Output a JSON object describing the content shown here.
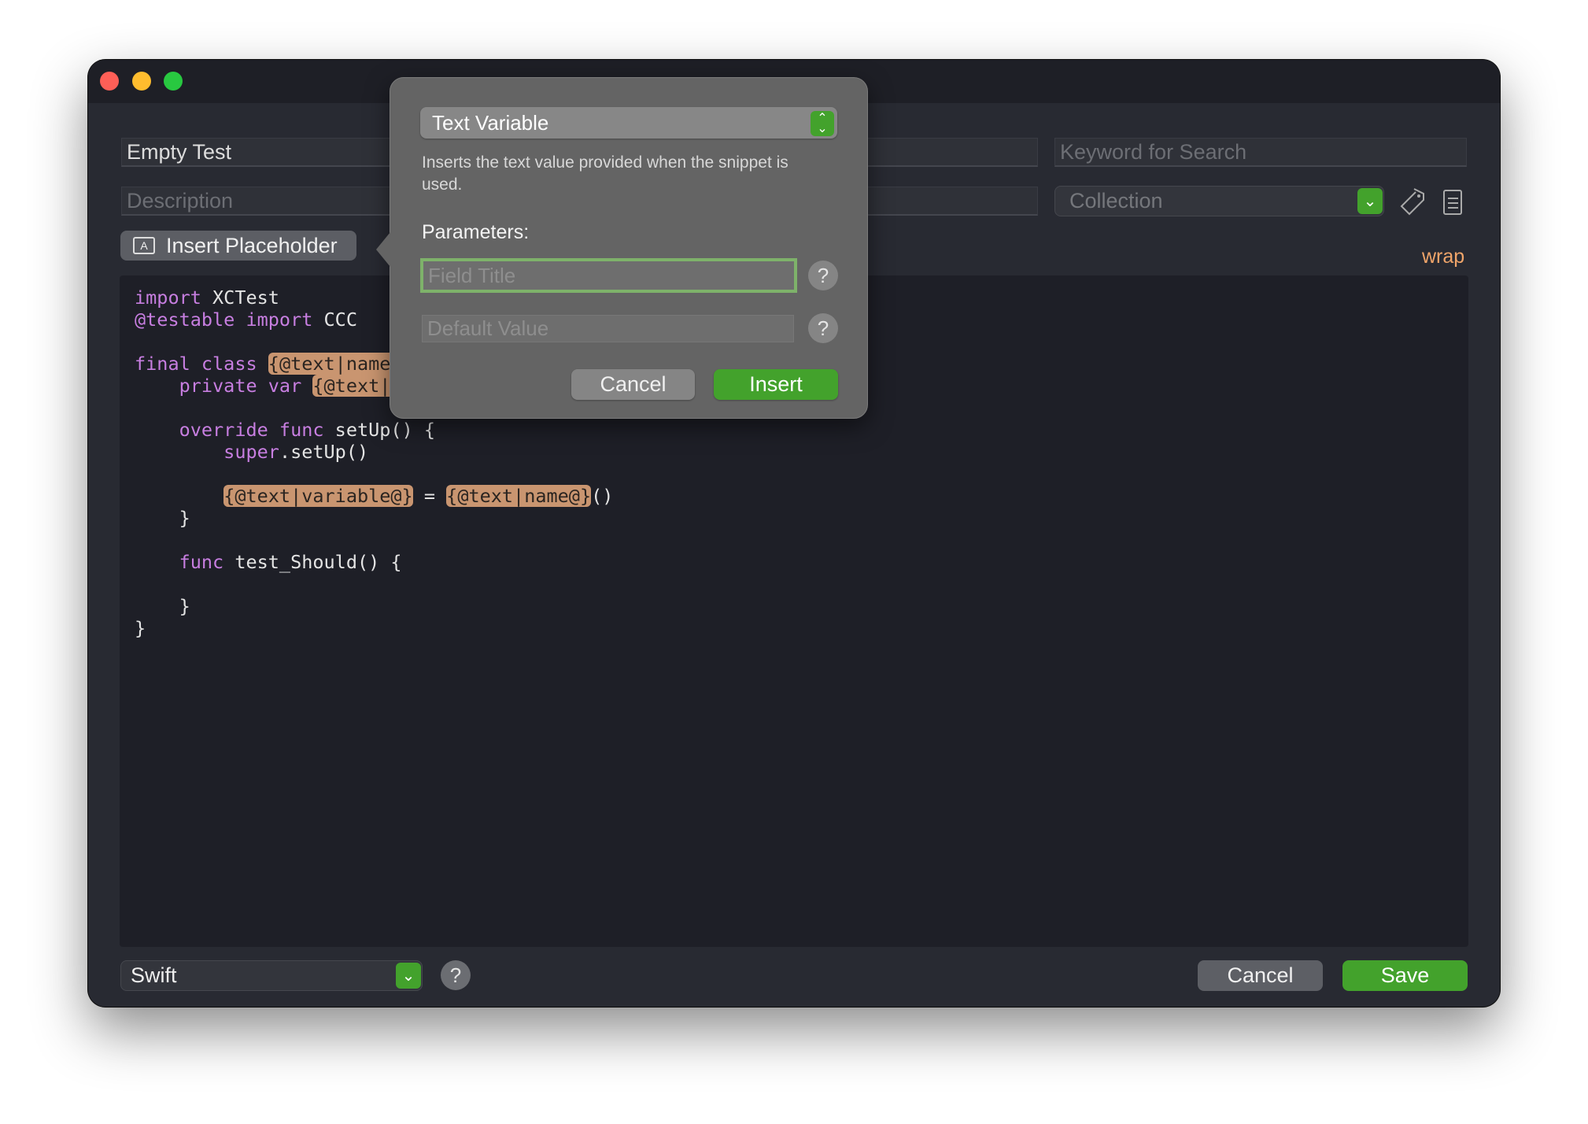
{
  "colors": {
    "accent": "#43a22c",
    "placeholder_highlight": "#c99570",
    "keyword": "#c77ee0",
    "wrap": "#f0a56a"
  },
  "form": {
    "name_value": "Empty Test",
    "description_placeholder": "Description",
    "keyword_placeholder": "Keyword for Search",
    "collection_placeholder": "Collection",
    "insert_placeholder_label": "Insert Placeholder",
    "wrap_label": "wrap"
  },
  "code": {
    "lines": [
      [
        {
          "t": "import",
          "k": "kw"
        },
        {
          "t": " XCTest",
          "k": "p"
        }
      ],
      [
        {
          "t": "@testable import",
          "k": "kw"
        },
        {
          "t": " CCC",
          "k": "p"
        }
      ],
      [],
      [
        {
          "t": "final class",
          "k": "kw"
        },
        {
          "t": " ",
          "k": "p"
        },
        {
          "t": "{@text|name@}",
          "k": "ph"
        }
      ],
      [
        {
          "t": "    private var",
          "k": "kw"
        },
        {
          "t": " ",
          "k": "p"
        },
        {
          "t": "{@text|variable@}",
          "k": "ph"
        }
      ],
      [],
      [
        {
          "t": "    override func",
          "k": "kw"
        },
        {
          "t": " setUp() {",
          "k": "p"
        }
      ],
      [
        {
          "t": "        super",
          "k": "kw"
        },
        {
          "t": ".setUp()",
          "k": "p"
        }
      ],
      [],
      [
        {
          "t": "        ",
          "k": "p"
        },
        {
          "t": "{@text|variable@}",
          "k": "ph"
        },
        {
          "t": " = ",
          "k": "p"
        },
        {
          "t": "{@text|name@}",
          "k": "ph"
        },
        {
          "t": "()",
          "k": "p"
        }
      ],
      [
        {
          "t": "    }",
          "k": "p"
        }
      ],
      [],
      [
        {
          "t": "    func",
          "k": "kw"
        },
        {
          "t": " test_Should() {",
          "k": "p"
        }
      ],
      [],
      [
        {
          "t": "    }",
          "k": "p"
        }
      ],
      [
        {
          "t": "}",
          "k": "p"
        }
      ]
    ]
  },
  "footer": {
    "language": "Swift",
    "help": "?",
    "cancel": "Cancel",
    "save": "Save"
  },
  "popover": {
    "type": "Text Variable",
    "description": "Inserts the text value provided when the snippet is used.",
    "parameters_label": "Parameters:",
    "field_title_placeholder": "Field Title",
    "default_value_placeholder": "Default Value",
    "help": "?",
    "cancel": "Cancel",
    "insert": "Insert"
  },
  "icons": {
    "placeholder": "placeholder-a-icon",
    "tag": "tag-icon",
    "list": "list-icon",
    "chevron": "chevron-down-icon",
    "updown": "chevron-up-down-icon"
  }
}
